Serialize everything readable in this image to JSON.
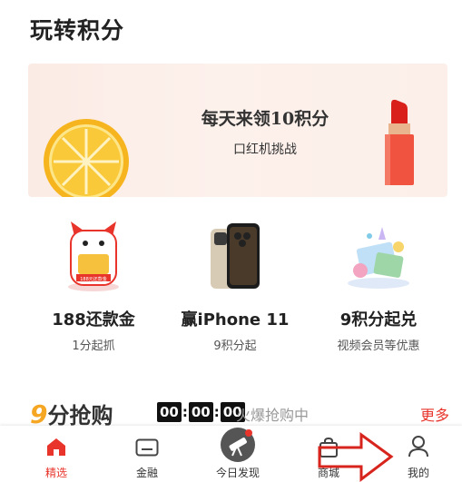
{
  "page_title": "玩转积分",
  "banner": {
    "headline": "每天来领10积分",
    "subline": "口红机挑战"
  },
  "cards": [
    {
      "title": "188还款金",
      "subtitle": "1分起抓",
      "badge_text": "188元还款金"
    },
    {
      "title": "赢iPhone 11",
      "subtitle": "9积分起"
    },
    {
      "title": "9积分起兑",
      "subtitle": "视频会员等优惠"
    }
  ],
  "flash_sale": {
    "logo_number": "9",
    "logo_text": "分抢购",
    "timer": [
      "00",
      "00",
      "00"
    ],
    "status": "火爆抢购中",
    "more_label": "更多"
  },
  "tabbar": {
    "items": [
      {
        "label": "精选",
        "icon": "home-icon",
        "active": true
      },
      {
        "label": "金融",
        "icon": "card-icon",
        "active": false
      },
      {
        "label": "今日发现",
        "icon": "telescope-icon",
        "active": false
      },
      {
        "label": "商城",
        "icon": "bag-icon",
        "active": false
      },
      {
        "label": "我的",
        "icon": "user-icon",
        "active": false
      }
    ]
  },
  "colors": {
    "accent": "#e8342b",
    "flash_nine": "#f5a623"
  }
}
